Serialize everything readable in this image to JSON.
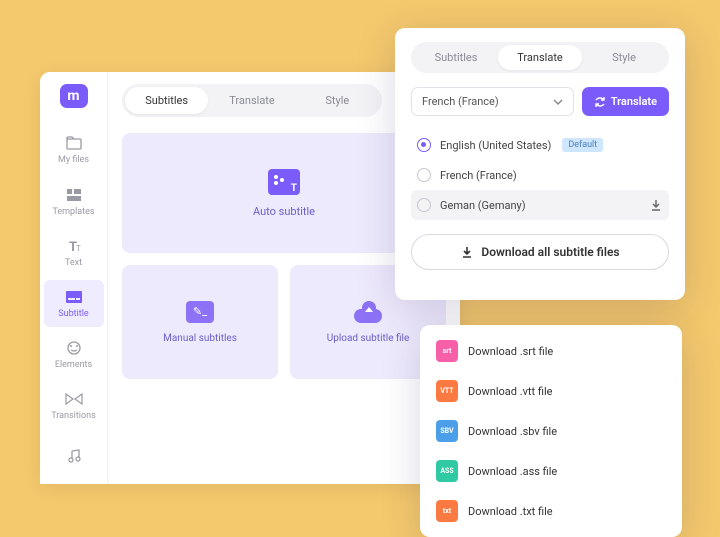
{
  "sidebar": {
    "items": [
      {
        "label": "My files"
      },
      {
        "label": "Templates"
      },
      {
        "label": "Text"
      },
      {
        "label": "Subtitle"
      },
      {
        "label": "Elements"
      },
      {
        "label": "Transitions"
      }
    ]
  },
  "content": {
    "tabs": {
      "subtitles": "Subtitles",
      "translate": "Translate",
      "style": "Style"
    },
    "auto": "Auto subtitle",
    "manual": "Manual subtitles",
    "upload": "Upload subtitle file"
  },
  "floating": {
    "tabs": {
      "subtitles": "Subtitles",
      "translate": "Translate",
      "style": "Style"
    },
    "languageSelect": "French (France)",
    "translateBtn": "Translate",
    "langs": [
      {
        "label": "English (United States)",
        "default": "Default"
      },
      {
        "label": "French (France)"
      },
      {
        "label": "Geman (Gemany)"
      }
    ],
    "downloadAll": "Download all subtitle files"
  },
  "files": [
    {
      "ext": "srt",
      "label": "Download .srt file",
      "color": "#f75fa8"
    },
    {
      "ext": "VTT",
      "label": "Download .vtt file",
      "color": "#fb7a41"
    },
    {
      "ext": "SBV",
      "label": "Download .sbv file",
      "color": "#4b9fe8"
    },
    {
      "ext": "ASS",
      "label": "Download .ass file",
      "color": "#2fc9a4"
    },
    {
      "ext": "txt",
      "label": "Download .txt file",
      "color": "#fb7a41"
    }
  ]
}
